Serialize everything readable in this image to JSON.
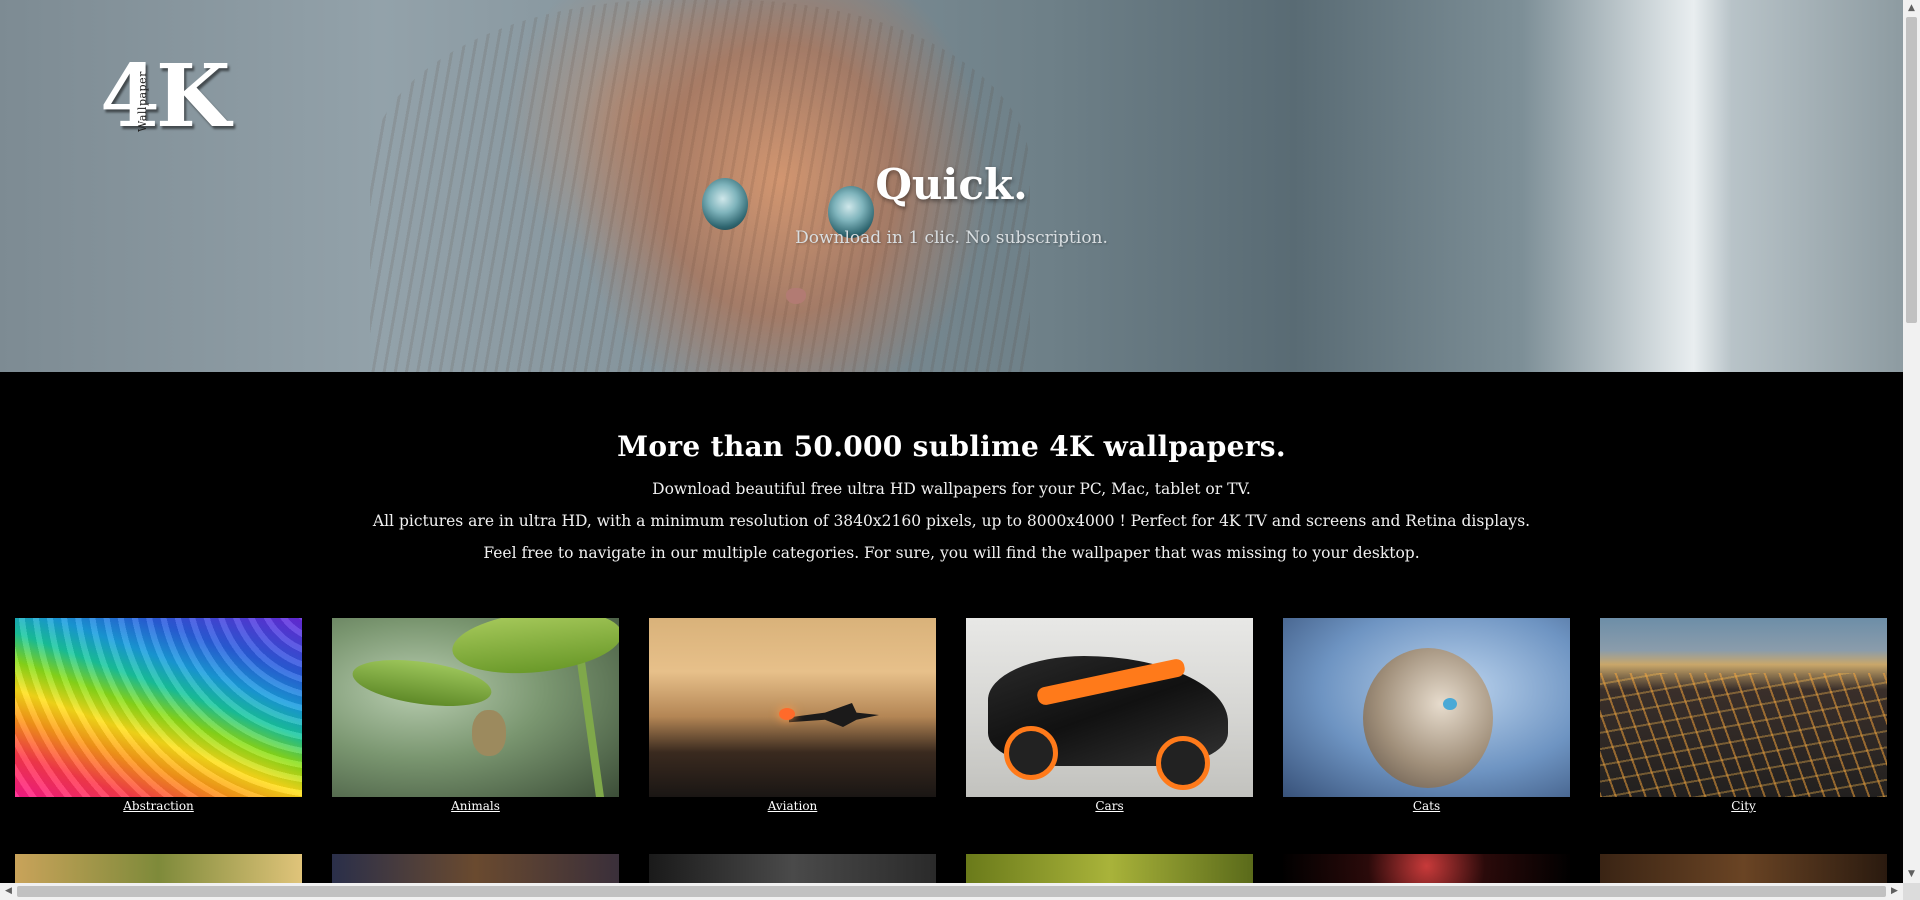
{
  "logo": {
    "digits": "4K",
    "sub": "Wallpaper"
  },
  "hero": {
    "title": "Quick.",
    "subtitle": "Download in 1 clic. No subscription."
  },
  "intro": {
    "heading": "More than 50.000 sublime 4K wallpapers.",
    "lines": [
      "Download beautiful free ultra HD wallpapers for your PC, Mac, tablet or TV.",
      "All pictures are in ultra HD, with a minimum resolution of 3840x2160 pixels, up to 8000x4000 ! Perfect for 4K TV and screens and Retina displays.",
      "Feel free to navigate in our multiple categories. For sure, you will find the wallpaper that was missing to your desktop."
    ]
  },
  "categories": [
    {
      "label": "Abstraction"
    },
    {
      "label": "Animals"
    },
    {
      "label": "Aviation"
    },
    {
      "label": "Cars"
    },
    {
      "label": "Cats"
    },
    {
      "label": "City"
    }
  ]
}
